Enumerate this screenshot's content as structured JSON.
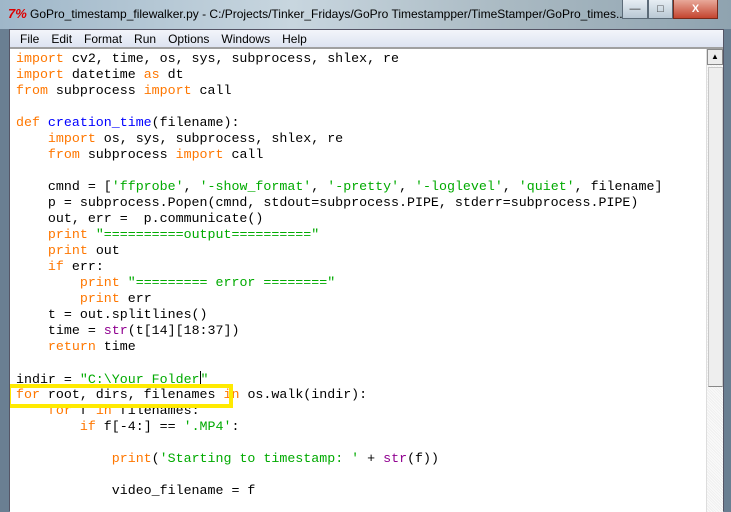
{
  "window": {
    "title": "GoPro_timestamp_filewalker.py - C:/Projects/Tinker_Fridays/GoPro Timestampper/TimeStamper/GoPro_times...",
    "icon": "7%",
    "minimize": "—",
    "maximize": "□",
    "close": "X"
  },
  "menu": [
    "File",
    "Edit",
    "Format",
    "Run",
    "Options",
    "Windows",
    "Help"
  ],
  "code": [
    [
      [
        "kw",
        "import"
      ],
      [
        "",
        "cv2, time, os, sys, subprocess, shlex, re"
      ]
    ],
    [
      [
        "kw",
        "import"
      ],
      [
        "",
        "datetime "
      ],
      [
        "kw",
        "as"
      ],
      [
        "",
        "dt"
      ]
    ],
    [
      [
        "kw",
        "from"
      ],
      [
        "",
        "subprocess "
      ],
      [
        "kw",
        "import"
      ],
      [
        "",
        "call"
      ]
    ],
    [],
    [
      [
        "kw",
        "def"
      ],
      [
        "df",
        "creation_time"
      ],
      [
        "",
        "(filename):"
      ]
    ],
    [
      [
        "",
        "    "
      ],
      [
        "kw",
        "import"
      ],
      [
        "",
        "os, sys, subprocess, shlex, re"
      ]
    ],
    [
      [
        "",
        "    "
      ],
      [
        "kw",
        "from"
      ],
      [
        "",
        "subprocess "
      ],
      [
        "kw",
        "import"
      ],
      [
        "",
        "call"
      ]
    ],
    [],
    [
      [
        "",
        "    cmnd = ["
      ],
      [
        "st",
        "'ffprobe'"
      ],
      [
        "",
        ", "
      ],
      [
        "st",
        "'-show_format'"
      ],
      [
        "",
        ", "
      ],
      [
        "st",
        "'-pretty'"
      ],
      [
        "",
        ", "
      ],
      [
        "st",
        "'-loglevel'"
      ],
      [
        "",
        ", "
      ],
      [
        "st",
        "'quiet'"
      ],
      [
        "",
        ", filename]"
      ]
    ],
    [
      [
        "",
        "    p = subprocess.Popen(cmnd, stdout=subprocess.PIPE, stderr=subprocess.PIPE)"
      ]
    ],
    [
      [
        "",
        "    out, err =  p.communicate()"
      ]
    ],
    [
      [
        "",
        "    "
      ],
      [
        "kw",
        "print"
      ],
      [
        "st",
        "\"==========output==========\""
      ]
    ],
    [
      [
        "",
        "    "
      ],
      [
        "kw",
        "print"
      ],
      [
        "",
        "out"
      ]
    ],
    [
      [
        "",
        "    "
      ],
      [
        "kw",
        "if"
      ],
      [
        "",
        "err:"
      ]
    ],
    [
      [
        "",
        "        "
      ],
      [
        "kw",
        "print"
      ],
      [
        "st",
        "\"========= error ========\""
      ]
    ],
    [
      [
        "",
        "        "
      ],
      [
        "kw",
        "print"
      ],
      [
        "",
        "err"
      ]
    ],
    [
      [
        "",
        "    t = out.splitlines()"
      ]
    ],
    [
      [
        "",
        "    time = "
      ],
      [
        "bi",
        "str"
      ],
      [
        "",
        "(t[14][18:37])"
      ]
    ],
    [
      [
        "",
        "    "
      ],
      [
        "kw",
        "return"
      ],
      [
        "",
        "time"
      ]
    ],
    [],
    [
      [
        "",
        "indir = "
      ],
      [
        "st",
        "\"C:\\Your Folder"
      ],
      [
        "caret",
        ""
      ],
      [
        "st",
        "\""
      ]
    ],
    [
      [
        "kw",
        "for"
      ],
      [
        "",
        "root, dirs, filenames "
      ],
      [
        "kw",
        "in"
      ],
      [
        "",
        "os.walk(indir):"
      ]
    ],
    [
      [
        "",
        "    "
      ],
      [
        "kw",
        "for"
      ],
      [
        "",
        "f "
      ],
      [
        "kw",
        "in"
      ],
      [
        "",
        "filenames:"
      ]
    ],
    [
      [
        "",
        "        "
      ],
      [
        "kw",
        "if"
      ],
      [
        "",
        "f[-4:] == "
      ],
      [
        "st",
        "'.MP4'"
      ],
      [
        "",
        ":"
      ]
    ],
    [],
    [
      [
        "",
        "            "
      ],
      [
        "kw",
        "print"
      ],
      [
        "",
        "("
      ],
      [
        "st",
        "'Starting to timestamp: '"
      ],
      [
        "",
        " + "
      ],
      [
        "bi",
        "str"
      ],
      [
        "",
        "(f))"
      ]
    ],
    [],
    [
      [
        "",
        "            video_filename = f"
      ]
    ]
  ]
}
